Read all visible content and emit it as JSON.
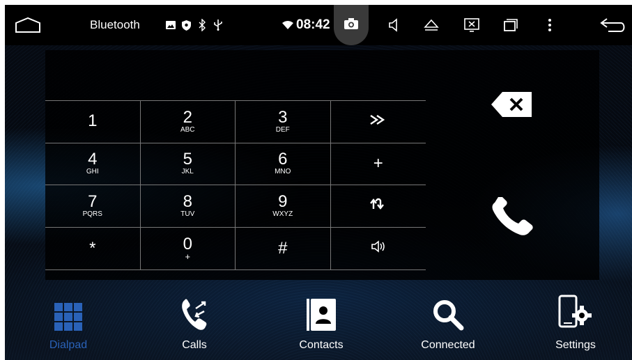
{
  "statusbar": {
    "app_title": "Bluetooth",
    "time": "08:42",
    "icons": [
      "home-icon",
      "image-icon",
      "shield-icon",
      "bluetooth-icon",
      "usb-icon",
      "wifi-icon",
      "camera-icon",
      "volume-icon",
      "eject-icon",
      "screen-off-icon",
      "recent-apps-icon",
      "more-icon",
      "back-icon"
    ]
  },
  "keypad": {
    "rows": [
      [
        {
          "digit": "1",
          "letters": ""
        },
        {
          "digit": "2",
          "letters": "ABC"
        },
        {
          "digit": "3",
          "letters": "DEF"
        },
        {
          "symbol": "≫",
          "icon": "forward-icon"
        }
      ],
      [
        {
          "digit": "4",
          "letters": "GHI"
        },
        {
          "digit": "5",
          "letters": "JKL"
        },
        {
          "digit": "6",
          "letters": "MNO"
        },
        {
          "symbol": "+",
          "icon": "plus-icon"
        }
      ],
      [
        {
          "digit": "7",
          "letters": "PQRS"
        },
        {
          "digit": "8",
          "letters": "TUV"
        },
        {
          "digit": "9",
          "letters": "WXYZ"
        },
        {
          "symbol": "⇅",
          "icon": "transfer-audio-icon"
        }
      ],
      [
        {
          "digit": "*",
          "letters": ""
        },
        {
          "digit": "0",
          "letters": "+"
        },
        {
          "digit": "#",
          "letters": ""
        },
        {
          "symbol": "🔈",
          "icon": "speaker-icon"
        }
      ]
    ]
  },
  "nav": {
    "items": [
      {
        "label": "Dialpad",
        "icon": "dialpad-grid-icon",
        "active": true
      },
      {
        "label": "Calls",
        "icon": "calls-icon",
        "active": false
      },
      {
        "label": "Contacts",
        "icon": "contacts-icon",
        "active": false
      },
      {
        "label": "Connected",
        "icon": "search-icon",
        "active": false
      },
      {
        "label": "Settings",
        "icon": "phone-settings-icon",
        "active": false
      }
    ]
  },
  "colors": {
    "accent": "#2a62b8",
    "background": "#04070d",
    "text": "#ffffff"
  }
}
